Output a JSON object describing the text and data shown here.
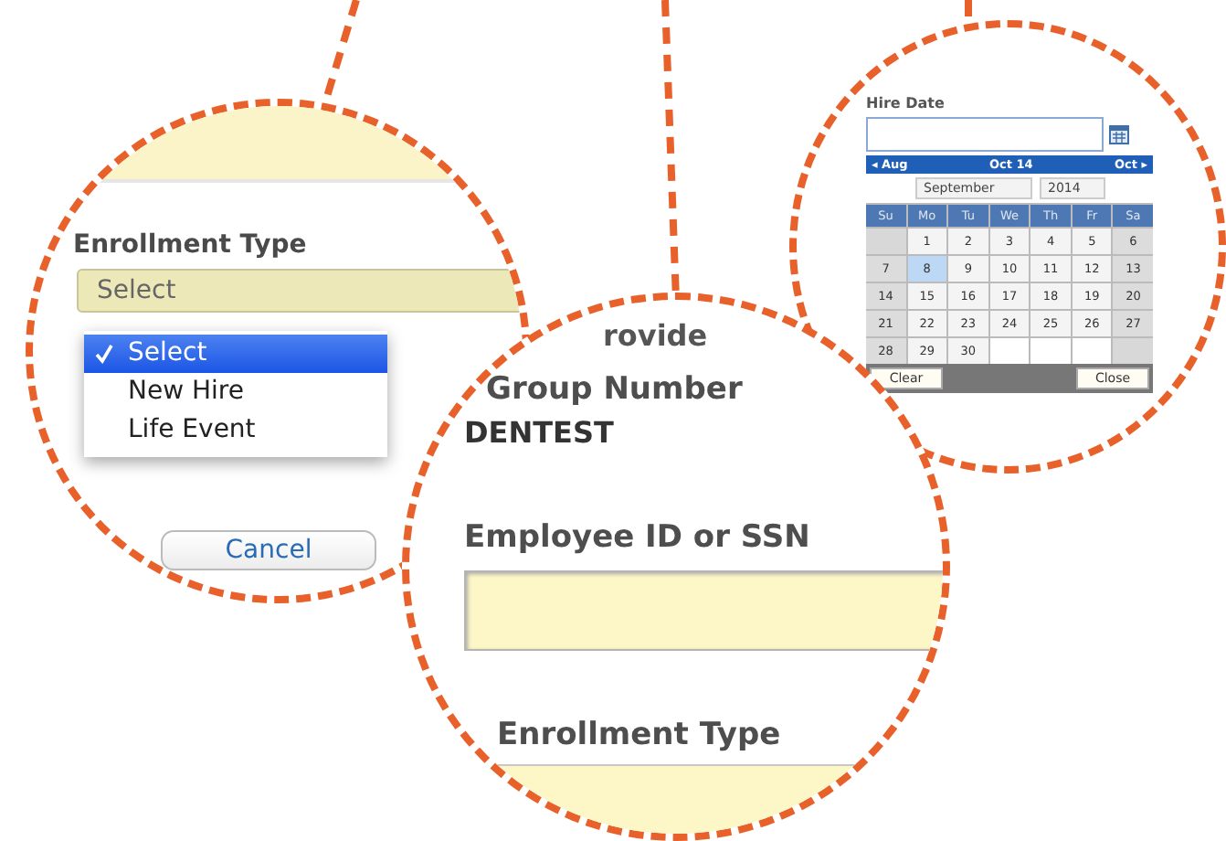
{
  "enrollment_popup": {
    "label": "Enrollment Type",
    "field_value": "Select",
    "options": [
      {
        "label": "Select",
        "selected": true
      },
      {
        "label": "New Hire",
        "selected": false
      },
      {
        "label": "Life Event",
        "selected": false
      }
    ],
    "cancel_button": "Cancel"
  },
  "form_detail": {
    "heading_fragment": "rovide",
    "group_number_label": "Group Number",
    "group_number_value": "DENTEST",
    "employee_id_label": "Employee ID or SSN",
    "enrollment_type_label": "Enrollment Type"
  },
  "hire_date_picker": {
    "label": "Hire Date",
    "prev_link": "◂ Aug",
    "current_link": "Oct 14",
    "next_link": "Oct ▸",
    "month": "September",
    "year": "2014",
    "weekdays": [
      "Su",
      "Mo",
      "Tu",
      "We",
      "Th",
      "Fr",
      "Sa"
    ],
    "weeks": [
      [
        {
          "kind": "blank"
        },
        {
          "day": "1",
          "selected": false
        },
        {
          "day": "2",
          "selected": false
        },
        {
          "day": "3",
          "selected": false
        },
        {
          "day": "4",
          "selected": false
        },
        {
          "day": "5",
          "selected": false
        },
        {
          "day": "6",
          "selected": false
        }
      ],
      [
        {
          "day": "7",
          "selected": false
        },
        {
          "day": "8",
          "selected": true
        },
        {
          "day": "9",
          "selected": false
        },
        {
          "day": "10",
          "selected": false
        },
        {
          "day": "11",
          "selected": false
        },
        {
          "day": "12",
          "selected": false
        },
        {
          "day": "13",
          "selected": false
        }
      ],
      [
        {
          "day": "14",
          "selected": false
        },
        {
          "day": "15",
          "selected": false
        },
        {
          "day": "16",
          "selected": false
        },
        {
          "day": "17",
          "selected": false
        },
        {
          "day": "18",
          "selected": false
        },
        {
          "day": "19",
          "selected": false
        },
        {
          "day": "20",
          "selected": false
        }
      ],
      [
        {
          "day": "21",
          "selected": false
        },
        {
          "day": "22",
          "selected": false
        },
        {
          "day": "23",
          "selected": false
        },
        {
          "day": "24",
          "selected": false
        },
        {
          "day": "25",
          "selected": false
        },
        {
          "day": "26",
          "selected": false
        },
        {
          "day": "27",
          "selected": false
        }
      ],
      [
        {
          "day": "28",
          "selected": false
        },
        {
          "day": "29",
          "selected": false
        },
        {
          "day": "30",
          "selected": false
        },
        {
          "kind": "blank"
        },
        {
          "kind": "blank"
        },
        {
          "kind": "blank"
        },
        {
          "kind": "blank"
        }
      ]
    ],
    "clear_button": "Clear",
    "close_button": "Close"
  }
}
